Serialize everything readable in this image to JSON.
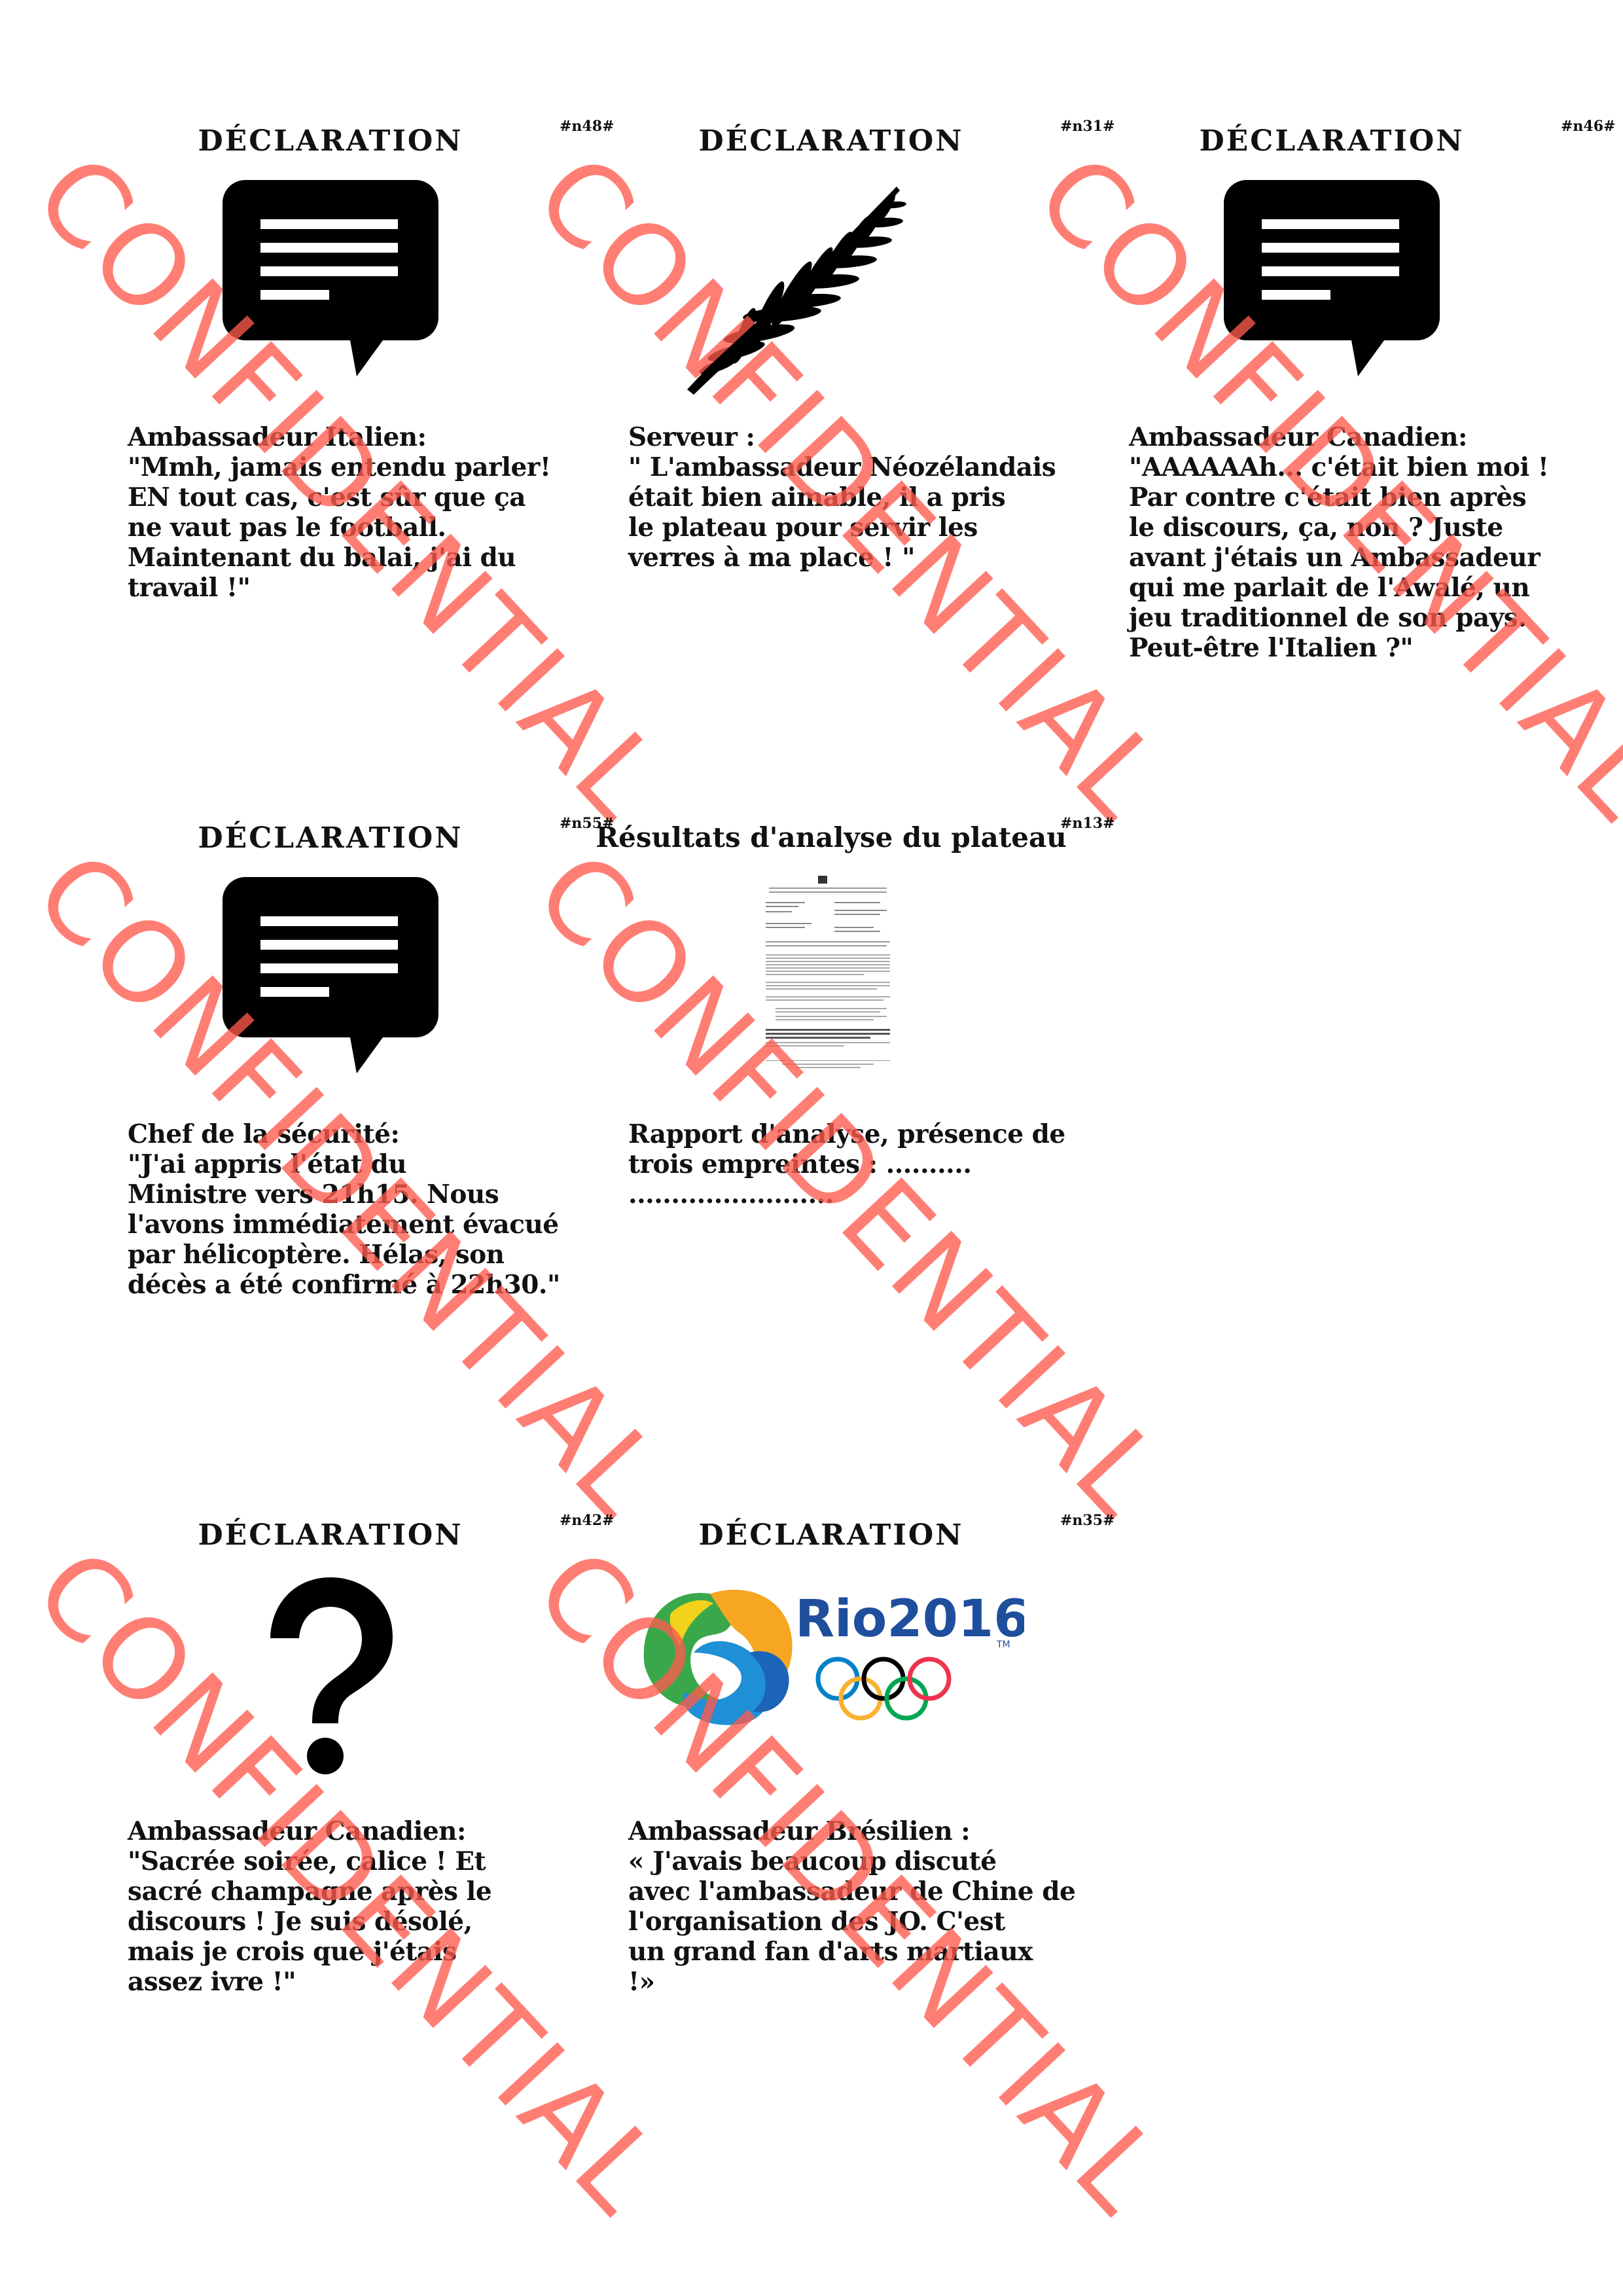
{
  "cards": [
    {
      "title": "DÉCLARATION",
      "id": "#n48#",
      "icon": "speech-bubble-icon",
      "lines": [
        "Ambassadeur Italien:",
        "\"Mmh, jamais entendu parler!",
        "EN tout cas, c'est sûr que  ça",
        "ne vaut pas le football.",
        "Maintenant du balai, j'ai du",
        "travail !\""
      ],
      "stamp": "CONFIDENTIAL"
    },
    {
      "title": "DÉCLARATION",
      "id": "#n31#",
      "icon": "fern-icon",
      "lines": [
        "Serveur :",
        "\" L'ambassadeur Néozélandais",
        "était bien aimable, il a pris",
        "le plateau pour servir les",
        "verres à ma place ! \""
      ],
      "stamp": "CONFIDENTIAL"
    },
    {
      "title": "DÉCLARATION",
      "id": "#n46#",
      "icon": "speech-bubble-icon",
      "lines": [
        "Ambassadeur Canadien:",
        "\"AAAAAAh... c'était bien moi !",
        "Par contre c'était bien après",
        "le discours, ça, non ? Juste",
        "avant j'étais un Ambassadeur",
        "qui me parlait de l'Awalé, un",
        "jeu traditionnel de son pays.",
        "Peut-être l'Italien ?\""
      ],
      "stamp": "CONFIDENTIAL"
    },
    {
      "title": "DÉCLARATION",
      "id": "#n55#",
      "icon": "speech-bubble-icon",
      "lines": [
        "Chef de la sécurité:",
        "\"J'ai appris l'état du",
        "Ministre vers 21h15. Nous",
        "l'avons immédiatement évacué",
        "par hélicoptère. Hélas, son",
        "décès a été confirmé à 22h30.\""
      ],
      "stamp": "CONFIDENTIAL"
    },
    {
      "title": "Résultats d'analyse du plateau",
      "id": "#n13#",
      "icon": "document-icon",
      "lines": [
        "Rapport d'analyse, présence de",
        "trois empreintes : ..........",
        "........................"
      ],
      "stamp": "CONFIDENTIAL"
    },
    {
      "title": "DÉCLARATION",
      "id": "#n42#",
      "icon": "question-mark-icon",
      "lines": [
        "Ambassadeur Canadien:",
        "\"Sacrée soirée, calice ! Et",
        "sacré champagne après le",
        "discours ! Je suis désolé,",
        "mais je crois que j'étais",
        "assez ivre !\""
      ],
      "stamp": "CONFIDENTIAL"
    },
    {
      "title": "DÉCLARATION",
      "id": "#n35#",
      "icon": "rio2016-logo-icon",
      "logo_text": "Rio2016",
      "logo_tm": "TM",
      "lines": [
        "Ambassadeur Brésilien :",
        "« J'avais beaucoup discuté",
        "avec l'ambassadeur de Chine de",
        "l'organisation des JO. C'est",
        "un grand fan d'arts martiaux",
        "!»"
      ],
      "stamp": "CONFIDENTIAL"
    }
  ],
  "colors": {
    "stamp": "#ff5a4e",
    "ink": "#111111",
    "rio_blue": "#1f4e9c",
    "ring_blue": "#0081c8",
    "ring_yellow": "#fcb131",
    "ring_black": "#000000",
    "ring_green": "#00a651",
    "ring_red": "#ee334e"
  }
}
